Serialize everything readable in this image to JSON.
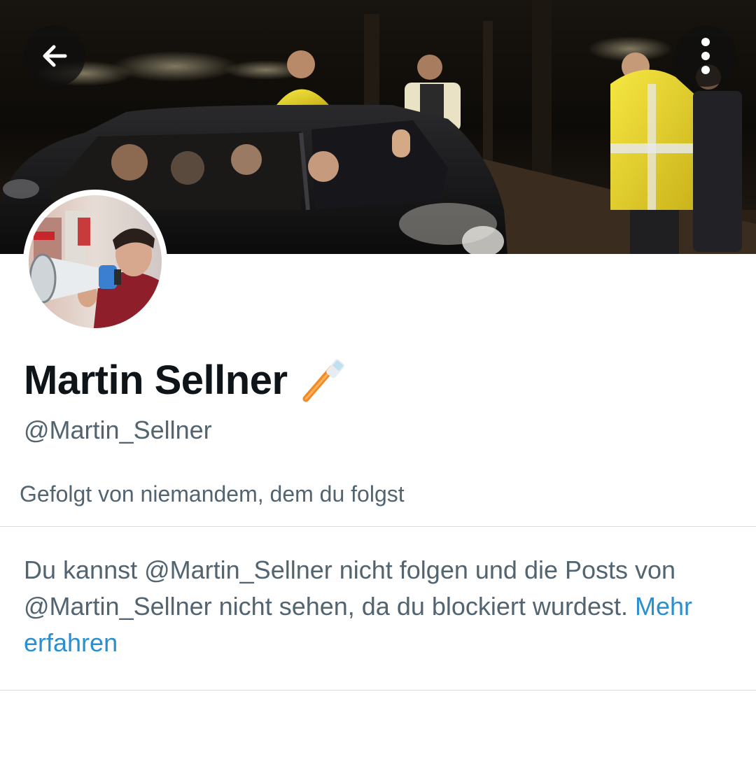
{
  "profile": {
    "display_name": "Martin Sellner",
    "name_emoji_icon": "toothbrush-icon",
    "handle": "@Martin_Sellner",
    "followed_by": "Gefolgt von niemandem, dem du folgst"
  },
  "notice": {
    "text": "Du kannst @Martin_Sellner nicht folgen und die Posts von @Martin_Sellner nicht sehen, da du blockiert wurdest.",
    "link_label": "Mehr erfahren"
  },
  "header": {
    "back_icon": "arrow-left-icon",
    "more_icon": "more-vertical-icon"
  },
  "colors": {
    "primary_text": "#0f1419",
    "secondary_text": "#536471",
    "link": "#2a8fd1",
    "divider": "#d9dde0"
  }
}
